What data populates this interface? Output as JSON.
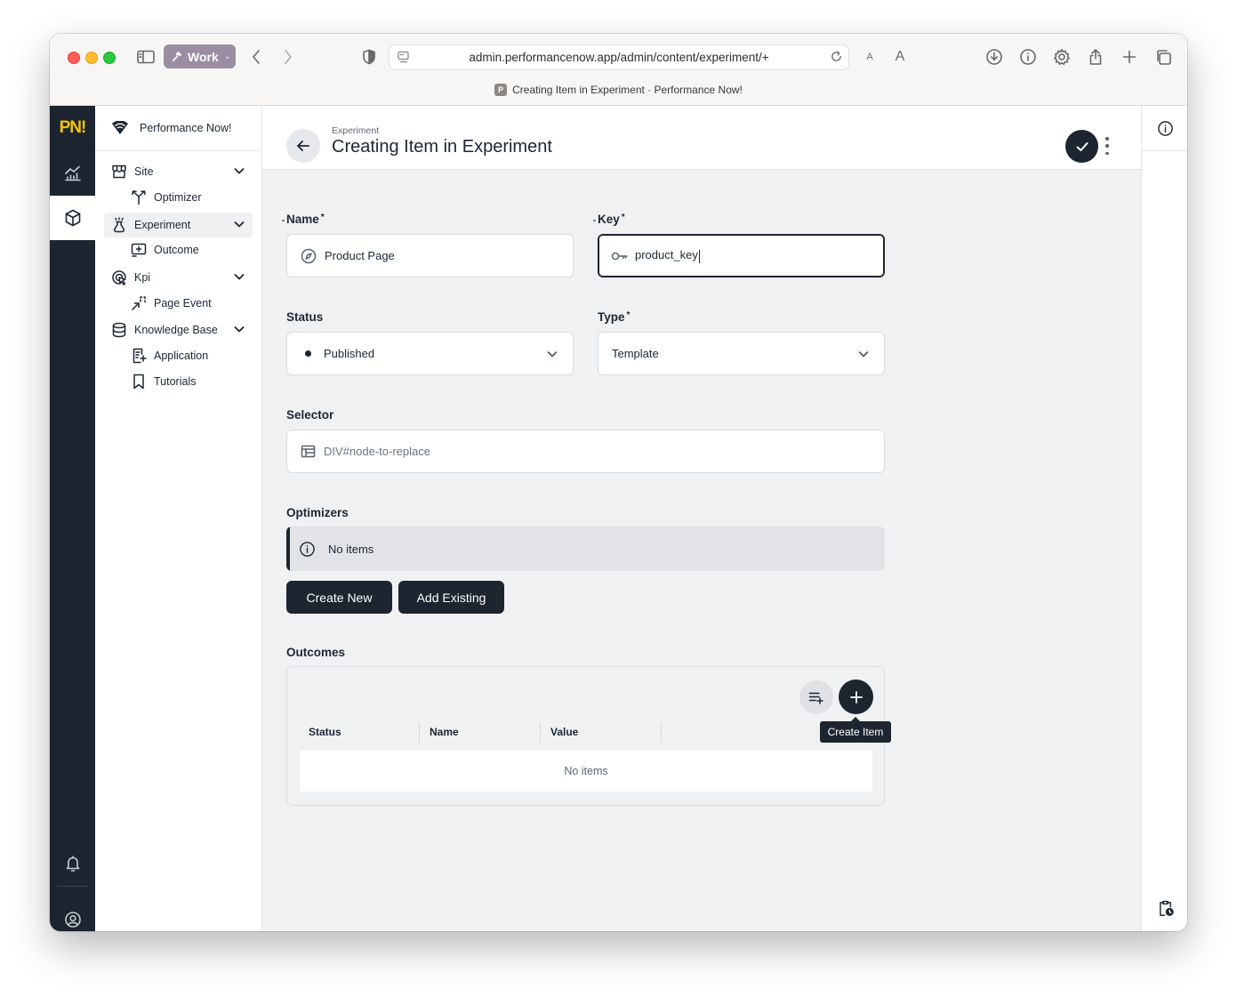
{
  "browser": {
    "profile_label": "Work",
    "url": "admin.performancenow.app/admin/content/experiment/+",
    "tab_title": "Creating Item in Experiment · Performance Now!",
    "tab_favicon_letter": "P",
    "reader_small": "A",
    "reader_large": "A"
  },
  "rail": {
    "logo": "PN!"
  },
  "sidenav": {
    "brand": "Performance Now!",
    "items": [
      {
        "label": "Site"
      },
      {
        "label": "Optimizer"
      },
      {
        "label": "Experiment"
      },
      {
        "label": "Outcome"
      },
      {
        "label": "Kpi"
      },
      {
        "label": "Page Event"
      },
      {
        "label": "Knowledge Base"
      },
      {
        "label": "Application"
      },
      {
        "label": "Tutorials"
      }
    ]
  },
  "header": {
    "breadcrumb": "Experiment",
    "title": "Creating Item in Experiment"
  },
  "form": {
    "name": {
      "label": "Name",
      "required": "*",
      "value": "Product Page"
    },
    "key": {
      "label": "Key",
      "required": "*",
      "value": "product_key"
    },
    "status": {
      "label": "Status",
      "value": "Published"
    },
    "type": {
      "label": "Type",
      "required": "*",
      "value": "Template"
    },
    "selector": {
      "label": "Selector",
      "placeholder": "DIV#node-to-replace"
    },
    "optimizers": {
      "label": "Optimizers",
      "empty_text": "No items",
      "create_new_label": "Create New",
      "add_existing_label": "Add Existing"
    },
    "outcomes": {
      "label": "Outcomes",
      "columns": [
        "Status",
        "Name",
        "Value"
      ],
      "empty_text": "No items",
      "tooltip": "Create Item"
    }
  },
  "colors": {
    "dark": "#1c2530",
    "accent_logo": "#f5c400",
    "background": "#f0f1f3"
  }
}
